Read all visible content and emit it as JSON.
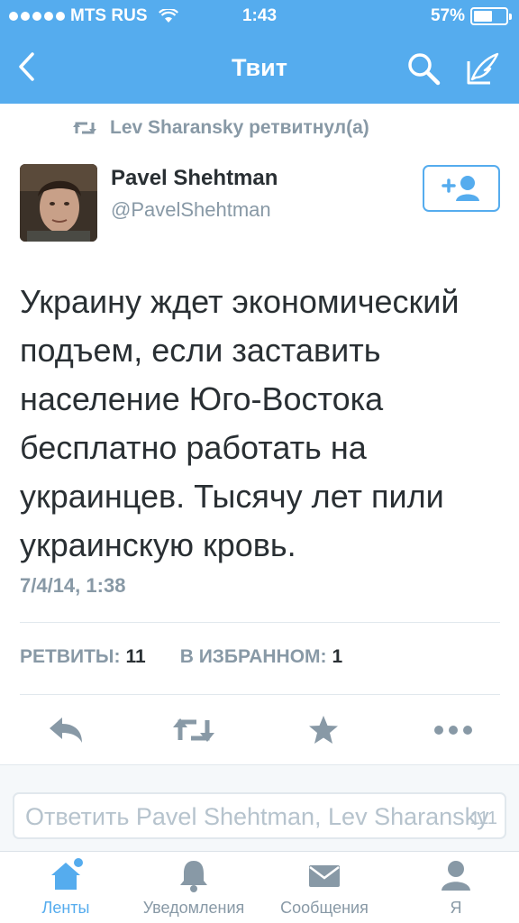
{
  "status_bar": {
    "carrier": "MTS RUS",
    "time": "1:43",
    "battery": "57%"
  },
  "nav": {
    "title": "Твит",
    "back_icon": "chevron-left-icon",
    "search_icon": "search-icon",
    "compose_icon": "compose-icon"
  },
  "retweet_line": {
    "text": "Lev Sharansky ретвитнул(а)"
  },
  "author": {
    "name": "Pavel Shehtman",
    "handle": "@PavelShehtman"
  },
  "tweet": {
    "text": "Украину ждет экономический подъем, если заставить население Юго-Востока бесплатно работать на украинцев. Тысячу лет пили украинскую кровь.",
    "date": "7/4/14, 1:38"
  },
  "stats": {
    "retweets_label": "РЕТВИТЫ:",
    "retweets_count": "11",
    "favorites_label": "В ИЗБРАННОМ:",
    "favorites_count": "1"
  },
  "reply": {
    "placeholder": "Ответить Pavel Shehtman, Lev Sharansky",
    "counter": "111"
  },
  "tabs": [
    {
      "label": "Ленты",
      "icon": "home-icon",
      "active": true
    },
    {
      "label": "Уведомления",
      "icon": "bell-icon",
      "active": false
    },
    {
      "label": "Сообщения",
      "icon": "envelope-icon",
      "active": false
    },
    {
      "label": "Я",
      "icon": "person-icon",
      "active": false
    }
  ],
  "colors": {
    "accent": "#55acee",
    "muted": "#8899a6",
    "text": "#292f33"
  }
}
